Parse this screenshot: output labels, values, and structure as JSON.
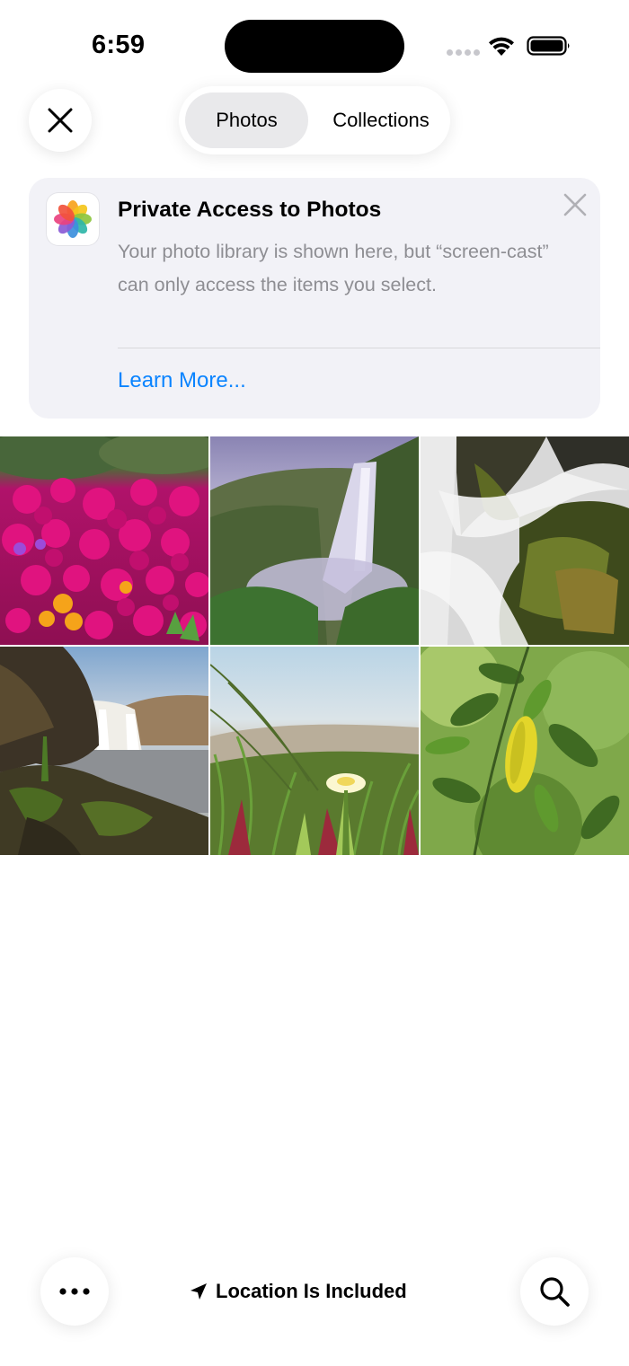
{
  "status_bar": {
    "time": "6:59",
    "icons": [
      "cell-signal-icon",
      "wifi-icon",
      "battery-icon"
    ]
  },
  "header": {
    "close_icon": "close-icon",
    "tabs": [
      {
        "label": "Photos",
        "selected": true
      },
      {
        "label": "Collections",
        "selected": false
      }
    ]
  },
  "banner": {
    "app_icon": "photos-app-icon",
    "title": "Private Access to Photos",
    "body": "Your photo library is shown here, but “screen-cast” can only access the items you select.",
    "link": "Learn More...",
    "close_icon": "close-icon"
  },
  "photos": [
    {
      "subject": "magenta-flowers"
    },
    {
      "subject": "waterfall-cliff"
    },
    {
      "subject": "waterfall-rocks"
    },
    {
      "subject": "waterfall-river"
    },
    {
      "subject": "white-flower-grass"
    },
    {
      "subject": "green-leaves"
    }
  ],
  "bottom_bar": {
    "more_icon": "ellipsis-icon",
    "location_icon": "location-arrow-icon",
    "location_label": "Location Is Included",
    "search_icon": "search-icon"
  },
  "colors": {
    "accent": "#0a84ff",
    "banner_bg": "#f2f2f7",
    "secondary_text": "#8e8e93",
    "segment_selected": "#e9e9eb"
  }
}
